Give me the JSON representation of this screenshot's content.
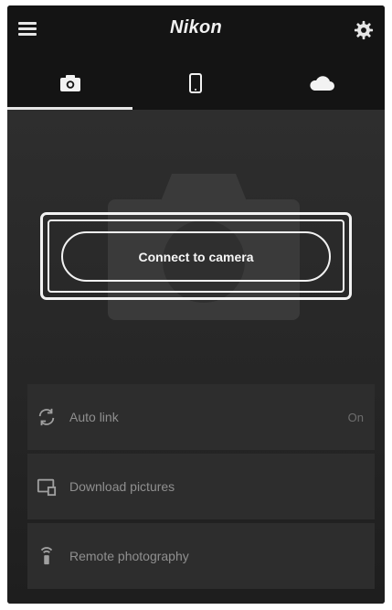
{
  "header": {
    "brand": "Nikon",
    "menu_icon": "menu-icon",
    "settings_icon": "gear-icon"
  },
  "tabs": [
    {
      "icon": "camera-icon",
      "active": true
    },
    {
      "icon": "smartphone-icon",
      "active": false
    },
    {
      "icon": "cloud-icon",
      "active": false
    }
  ],
  "main": {
    "connect_label": "Connect to camera",
    "background_icon": "camera-icon"
  },
  "list": [
    {
      "icon": "sync-icon",
      "label": "Auto link",
      "value": "On"
    },
    {
      "icon": "download-icon",
      "label": "Download pictures",
      "value": ""
    },
    {
      "icon": "remote-icon",
      "label": "Remote photography",
      "value": ""
    }
  ],
  "colors": {
    "app_bg": "#202020",
    "bar_bg": "#141414",
    "accent": "#f2f2f2",
    "row_bg": "#2d2d2d"
  }
}
